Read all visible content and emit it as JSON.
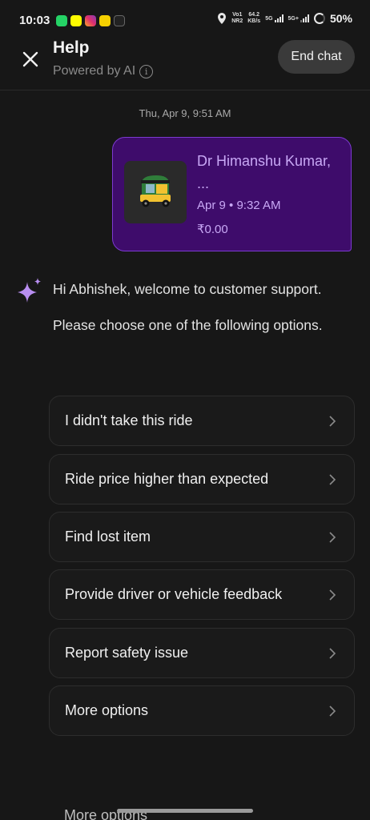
{
  "status_bar": {
    "time": "10:03",
    "network_top": "Vo1",
    "network_bottom": "NR2",
    "speed_top": "64.2",
    "speed_bottom": "KB/s",
    "sim1": "5G",
    "sim2": "5G+",
    "battery": "50%"
  },
  "header": {
    "title": "Help",
    "subtitle": "Powered by AI",
    "end_chat_label": "End chat"
  },
  "timestamp": "Thu, Apr 9, 9:51 AM",
  "trip": {
    "name": "Dr Himanshu Kumar, ...",
    "date": "Apr 9 • 9:32 AM",
    "price": "₹0.00",
    "vehicle_icon": "auto-rickshaw-icon"
  },
  "bot": {
    "greeting": "Hi Abhishek, welcome to customer support.",
    "prompt": "Please choose one of the following options."
  },
  "options": [
    "I didn't take this ride",
    "Ride price higher than expected",
    "Find lost item",
    "Provide driver or vehicle feedback",
    "Report safety issue",
    "More options"
  ],
  "ghost_text": "More options",
  "colors": {
    "background": "#171717",
    "accent_purple": "#3e0c6b",
    "accent_border": "#7c3ad0",
    "accent_text": "#c8a8f5",
    "sparkle": "#b88ef0"
  }
}
